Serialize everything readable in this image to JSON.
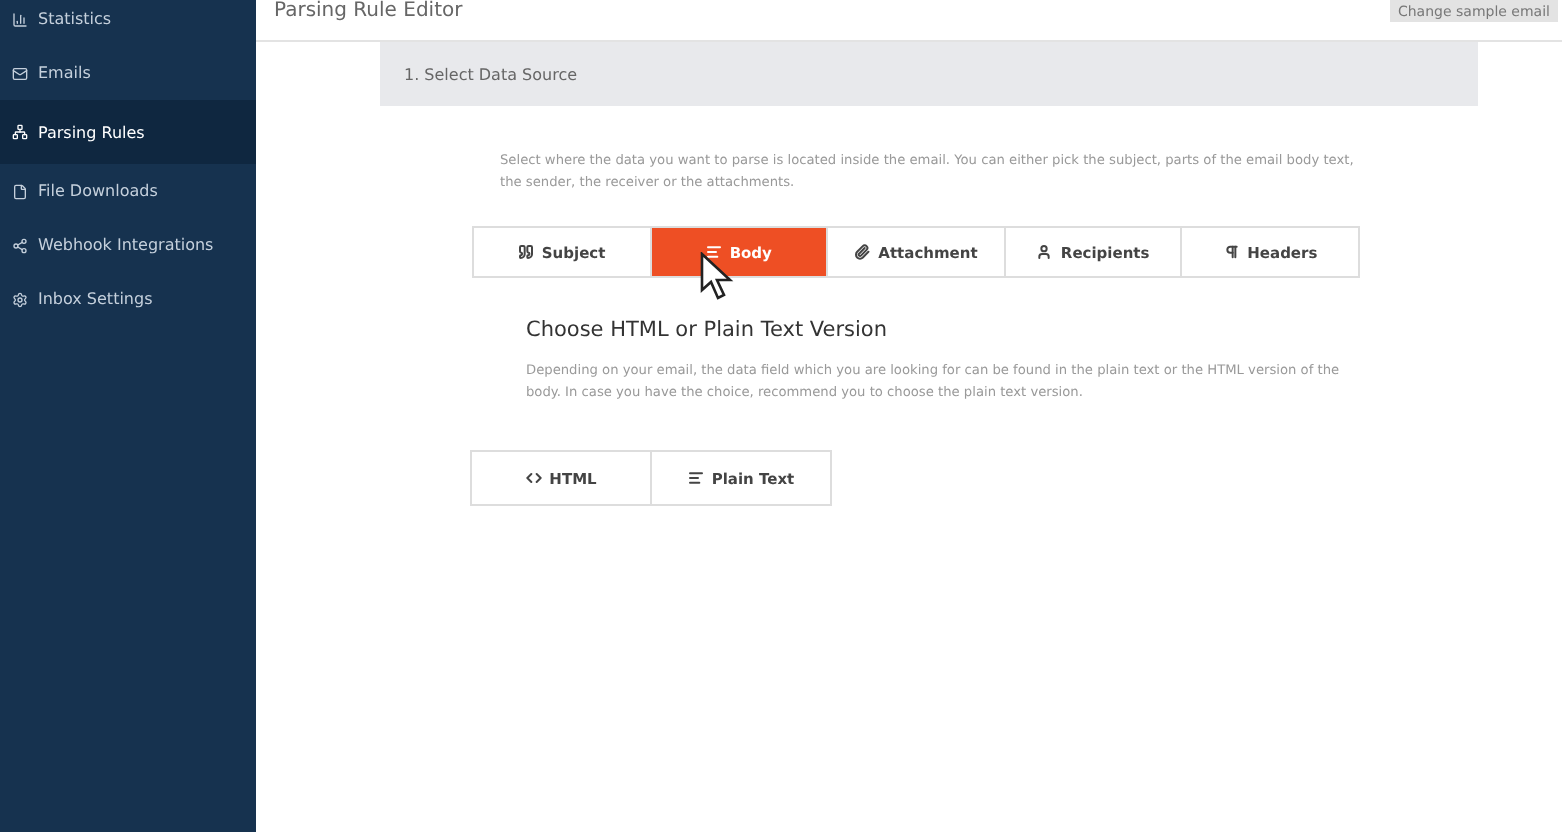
{
  "sidebar": {
    "items": [
      {
        "label": "Statistics",
        "selected": false
      },
      {
        "label": "Emails",
        "selected": false
      },
      {
        "label": "Parsing Rules",
        "selected": true
      },
      {
        "label": "File Downloads",
        "selected": false
      },
      {
        "label": "Webhook Integrations",
        "selected": false
      },
      {
        "label": "Inbox Settings",
        "selected": false
      }
    ]
  },
  "header": {
    "title": "Parsing Rule Editor",
    "action": "Change sample email"
  },
  "step": {
    "title": "1. Select Data Source"
  },
  "intro": "Select where the data you want to parse is located inside the email. You can either pick the subject, parts of the email body text, the sender, the receiver or the attachments.",
  "sources": [
    {
      "label": "Subject",
      "selected": false
    },
    {
      "label": "Body",
      "selected": true
    },
    {
      "label": "Attachment",
      "selected": false
    },
    {
      "label": "Recipients",
      "selected": false
    },
    {
      "label": "Headers",
      "selected": false
    }
  ],
  "version": {
    "heading": "Choose HTML or Plain Text Version",
    "text": "Depending on your email, the data field which you are looking for can be found in the plain text or the HTML version of the body. In case you have the choice, recommend you to choose the plain text version.",
    "options": [
      {
        "label": "HTML",
        "selected": false
      },
      {
        "label": "Plain Text",
        "selected": false
      }
    ]
  }
}
